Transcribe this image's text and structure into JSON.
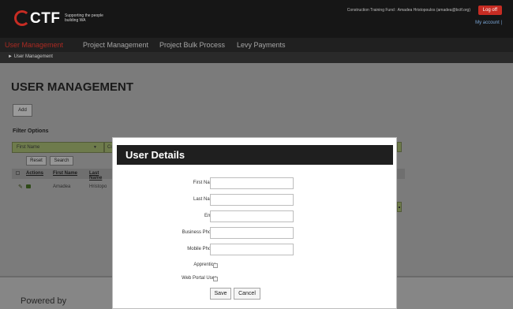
{
  "header": {
    "logo_text": "CTF",
    "logo_tagline": "Supporting the people building WA",
    "user_info": "Construction Training Fund : Amadea Hristopoulos (amadea@bctf.org)",
    "logout_label": "Log off",
    "my_account_label": "My account |"
  },
  "nav": {
    "items": [
      {
        "label": "User Management"
      },
      {
        "label": "Project Management"
      },
      {
        "label": "Project Bulk Process"
      },
      {
        "label": "Levy Payments"
      }
    ],
    "breadcrumb": "► User Management"
  },
  "main": {
    "title": "USER MANAGEMENT",
    "add_label": "Add",
    "filter_label": "Filter Options",
    "filter_field_value": "First Name",
    "filter_strip_text": "Co",
    "reset_label": "Reset",
    "search_label": "Search",
    "table": {
      "columns": [
        "Actions",
        "First Name",
        "Last Name"
      ],
      "rows": [
        {
          "first_name": "Amadea",
          "last_name": "Hristopo"
        }
      ]
    },
    "footer_text": "Powered by"
  },
  "modal": {
    "title": "User Details",
    "fields": [
      {
        "label": "First Name",
        "value": ""
      },
      {
        "label": "Last Name",
        "value": ""
      },
      {
        "label": "Email",
        "value": ""
      },
      {
        "label": "Business Phone",
        "value": ""
      },
      {
        "label": "Mobile Phone",
        "value": ""
      }
    ],
    "checkboxes": [
      {
        "label": "Apprentice"
      },
      {
        "label": "Web Portal User"
      }
    ],
    "save_label": "Save",
    "cancel_label": "Cancel"
  },
  "colors": {
    "accent_red": "#c72c23",
    "header_bg": "#161616",
    "filter_olive": "#6e7b4c",
    "link_blue": "#7aa6d6"
  }
}
